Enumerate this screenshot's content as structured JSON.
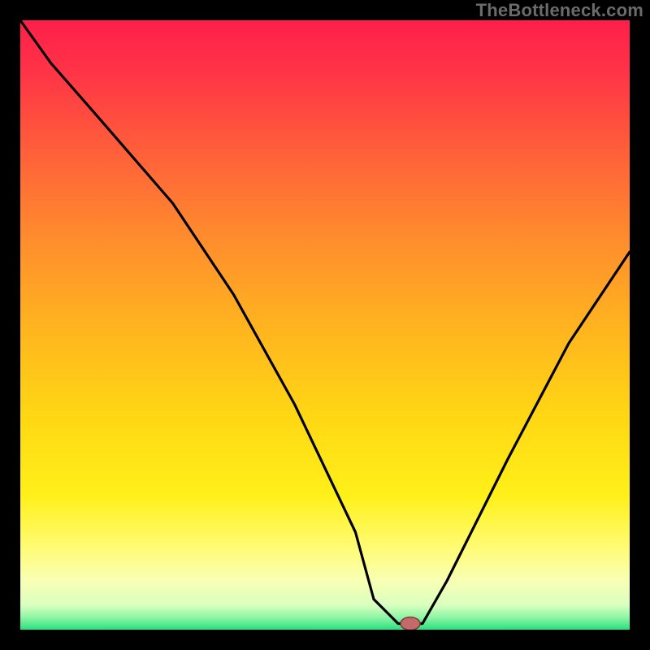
{
  "attribution": "TheBottleneck.com",
  "colors": {
    "gradient": {
      "c0": "#ff1f4a",
      "c1": "#ff3247",
      "c2": "#ff5a3b",
      "c3": "#ff8a2e",
      "c4": "#ffb31f",
      "c5": "#ffd714",
      "c6": "#fff019",
      "c7": "#fffb6e",
      "c8": "#f9ffb4",
      "c9": "#d9ffbf",
      "c10": "#8ef5a5",
      "c11": "#28e07e"
    },
    "marker_fill": "#c46a6a",
    "marker_stroke": "#7a3b3b"
  },
  "chart_data": {
    "type": "line",
    "title": "",
    "xlabel": "",
    "ylabel": "",
    "xlim": [
      0,
      100
    ],
    "ylim": [
      0,
      100
    ],
    "grid": false,
    "series": [
      {
        "name": "bottleneck-curve",
        "x": [
          0,
          5,
          12,
          25,
          35,
          45,
          55,
          58,
          62,
          66,
          70,
          80,
          90,
          100
        ],
        "values": [
          100,
          93,
          85,
          70,
          55,
          37,
          16,
          5,
          1,
          1,
          8,
          28,
          47,
          62
        ]
      }
    ],
    "marker": {
      "x": 64,
      "y": 1
    },
    "notes": "Values estimated from pixel positions relative to the 750x750 plot area; y=0 is bottom (green band), y=100 is top (red)."
  }
}
